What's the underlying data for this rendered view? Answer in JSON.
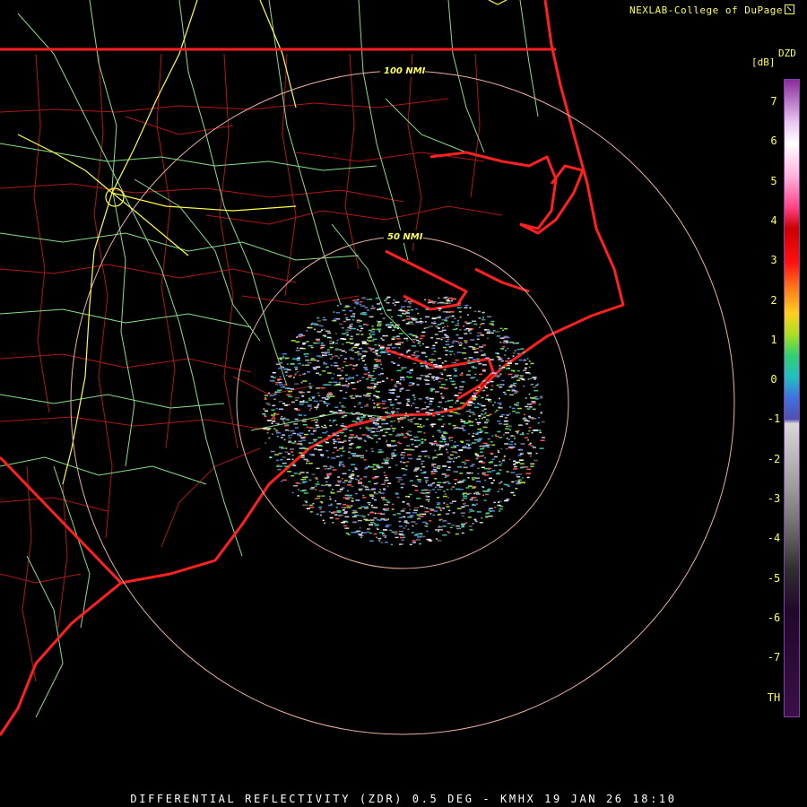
{
  "credit": "NEXLAB-College of DuPage",
  "footer": "DIFFERENTIAL REFLECTIVITY (ZDR) 0.5 DEG - KMHX 19 JAN 26 18:10",
  "product_code": "DZD",
  "units": "[dB]",
  "range_rings": [
    "100 NMI",
    "50 NMI"
  ],
  "colorbar": {
    "ticks": [
      "7",
      "6",
      "5",
      "4",
      "3",
      "2",
      "1",
      "0",
      "-1",
      "-2",
      "-3",
      "-4",
      "-5",
      "-6",
      "-7",
      "TH"
    ],
    "gradient": [
      {
        "value": 7.5,
        "color": "#8a2a9c"
      },
      {
        "value": 6.5,
        "color": "#e8c8f0"
      },
      {
        "value": 6,
        "color": "#ffffff"
      },
      {
        "value": 5.2,
        "color": "#ffb0d8"
      },
      {
        "value": 4.5,
        "color": "#ff4488"
      },
      {
        "value": 4,
        "color": "#cc0000"
      },
      {
        "value": 3.2,
        "color": "#ff1010"
      },
      {
        "value": 2.6,
        "color": "#ff7a1a"
      },
      {
        "value": 2,
        "color": "#ffd020"
      },
      {
        "value": 1.5,
        "color": "#a8e020"
      },
      {
        "value": 1,
        "color": "#30d070"
      },
      {
        "value": 0.5,
        "color": "#20c0c0"
      },
      {
        "value": 0,
        "color": "#4070e0"
      },
      {
        "value": -0.5,
        "color": "#5050b0"
      },
      {
        "value": -0.6,
        "color": "#d8d8d8"
      },
      {
        "value": -2,
        "color": "#a0a0a0"
      },
      {
        "value": -3,
        "color": "#707070"
      },
      {
        "value": -4,
        "color": "#303030"
      },
      {
        "value": -5,
        "color": "#200828"
      },
      {
        "value": -7.5,
        "color": "#3a1048"
      }
    ]
  },
  "colors": {
    "state_border": "#ff2020",
    "county_border": "#b01818",
    "highways": "#88dd88",
    "interstates": "#ffff44",
    "range_rings": "#e8b0a0",
    "text": "#ffff55",
    "background": "#000000"
  }
}
